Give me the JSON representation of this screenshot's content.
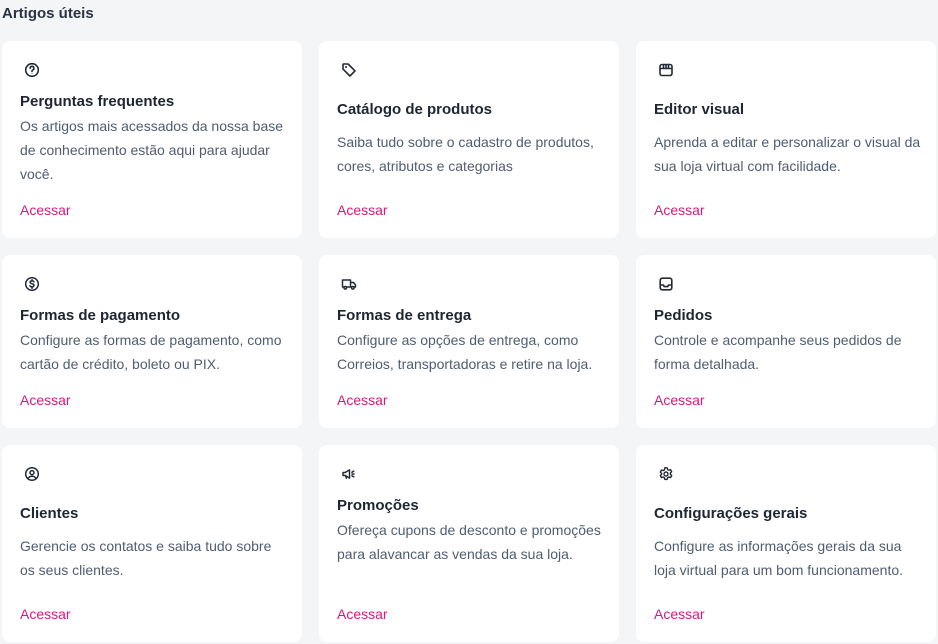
{
  "section": {
    "title": "Artigos úteis"
  },
  "accent_color": "#d6197d",
  "cards": [
    {
      "icon": "question-circle-icon",
      "title": "Perguntas frequentes",
      "description": "Os artigos mais acessados da nossa base de conhecimento estão aqui para ajudar você.",
      "link": "Acessar"
    },
    {
      "icon": "tag-icon",
      "title": "Catálogo de produtos",
      "description": "Saiba tudo sobre o cadastro de produtos, cores, atributos e categorias",
      "link": "Acessar"
    },
    {
      "icon": "storefront-icon",
      "title": "Editor visual",
      "description": "Aprenda a editar e personalizar o visual da sua loja virtual com facilidade.",
      "link": "Acessar"
    },
    {
      "icon": "dollar-circle-icon",
      "title": "Formas de pagamento",
      "description": "Configure as formas de pagamento, como cartão de crédito, boleto ou PIX.",
      "link": "Acessar"
    },
    {
      "icon": "truck-icon",
      "title": "Formas de entrega",
      "description": "Configure as opções de entrega, como Correios, transportadoras e retire na loja.",
      "link": "Acessar"
    },
    {
      "icon": "inbox-icon",
      "title": "Pedidos",
      "description": "Controle e acompanhe seus pedidos de forma detalhada.",
      "link": "Acessar"
    },
    {
      "icon": "user-circle-icon",
      "title": "Clientes",
      "description": "Gerencie os contatos e saiba tudo sobre os seus clientes.",
      "link": "Acessar"
    },
    {
      "icon": "megaphone-icon",
      "title": "Promoções",
      "description": "Ofereça cupons de desconto e promoções para alavancar as vendas da sua loja.",
      "link": "Acessar"
    },
    {
      "icon": "gear-icon",
      "title": "Configurações gerais",
      "description": "Configure as informações gerais da sua loja virtual para um bom funcionamento.",
      "link": "Acessar"
    }
  ]
}
